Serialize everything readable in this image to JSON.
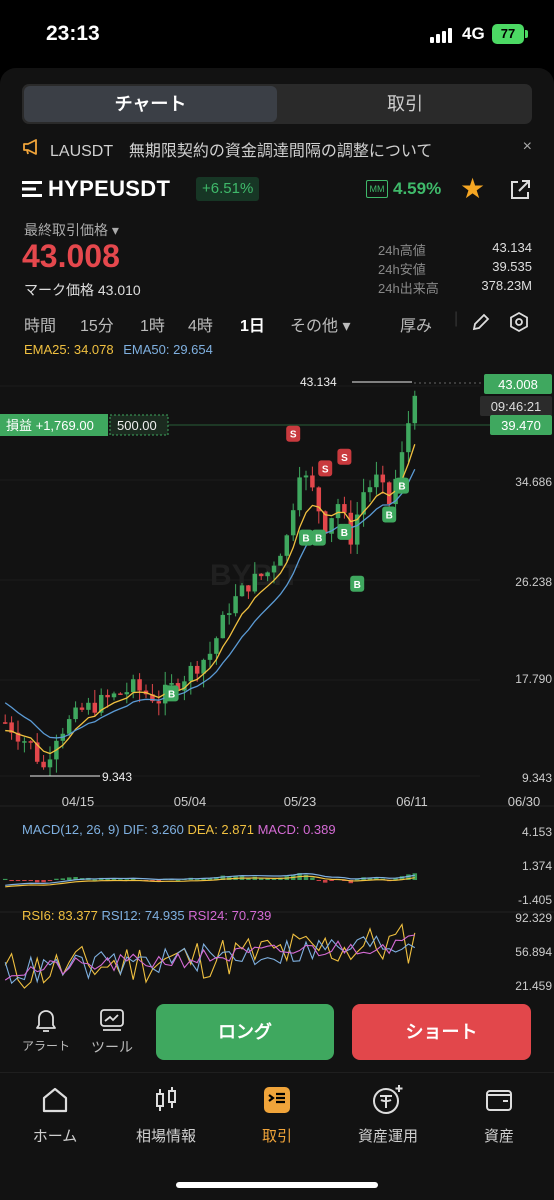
{
  "status_bar": {
    "time": "23:13",
    "network": "4G",
    "battery": "77"
  },
  "tabs": {
    "chart": "チャート",
    "trade": "取引"
  },
  "notice": {
    "text": "LAUSDT　無期限契約の資金調達間隔の調整について",
    "close": "×"
  },
  "symbol": {
    "name": "HYPEUSDT",
    "change": "+6.51%",
    "mm_label": "MM",
    "mm_value": "4.59%"
  },
  "price": {
    "label": "最終取引価格 ▾",
    "last": "43.008",
    "mark_label": "マーク価格",
    "mark": "43.010"
  },
  "stats": [
    {
      "k": "24h高値",
      "v": "43.134"
    },
    {
      "k": "24h安値",
      "v": "39.535"
    },
    {
      "k": "24h出来高",
      "v": "378.23M"
    }
  ],
  "timeframes": [
    "時間",
    "15分",
    "1時",
    "4時",
    "1日",
    "その他 ▾",
    "厚み"
  ],
  "selected_timeframe": "1日",
  "ema": {
    "ema25": "EMA25: 34.078",
    "ema50": "EMA50: 29.654"
  },
  "chart_data": {
    "type": "candlestick",
    "y_ticks": [
      "43.008",
      "34.686",
      "26.238",
      "17.790",
      "9.343"
    ],
    "x_ticks": [
      "04/15",
      "05/04",
      "05/23",
      "06/11",
      "06/30"
    ],
    "high_label": "43.134",
    "low_label": "9.343",
    "last_price": "43.008",
    "countdown": "09:46:21",
    "order_price": "39.470",
    "pnl_label": "損益 +1,769.00",
    "qty_label": "500.00",
    "watermark": "BYBIT",
    "buy_marker": "B",
    "sell_marker": "S",
    "macd": {
      "label": "MACD(12, 26, 9)",
      "dif": "DIF: 3.260",
      "dea": "DEA: 2.871",
      "macd": "MACD: 0.389",
      "ticks": [
        "4.153",
        "1.374",
        "-1.405"
      ]
    },
    "rsi": {
      "rsi6": "RSI6: 83.377",
      "rsi12": "RSI12: 74.935",
      "rsi24": "RSI24: 70.739",
      "ticks": [
        "92.329",
        "56.894",
        "21.459"
      ]
    },
    "colors": {
      "up": "#3fa85f",
      "down": "#e2474b",
      "ema25": "#f0c040",
      "ema50": "#5b9bd5"
    }
  },
  "actions": {
    "alert": "アラート",
    "tool": "ツール",
    "long": "ロング",
    "short": "ショート"
  },
  "bottom_nav": [
    "ホーム",
    "相場情報",
    "取引",
    "資産運用",
    "資産"
  ],
  "active_nav": "取引"
}
